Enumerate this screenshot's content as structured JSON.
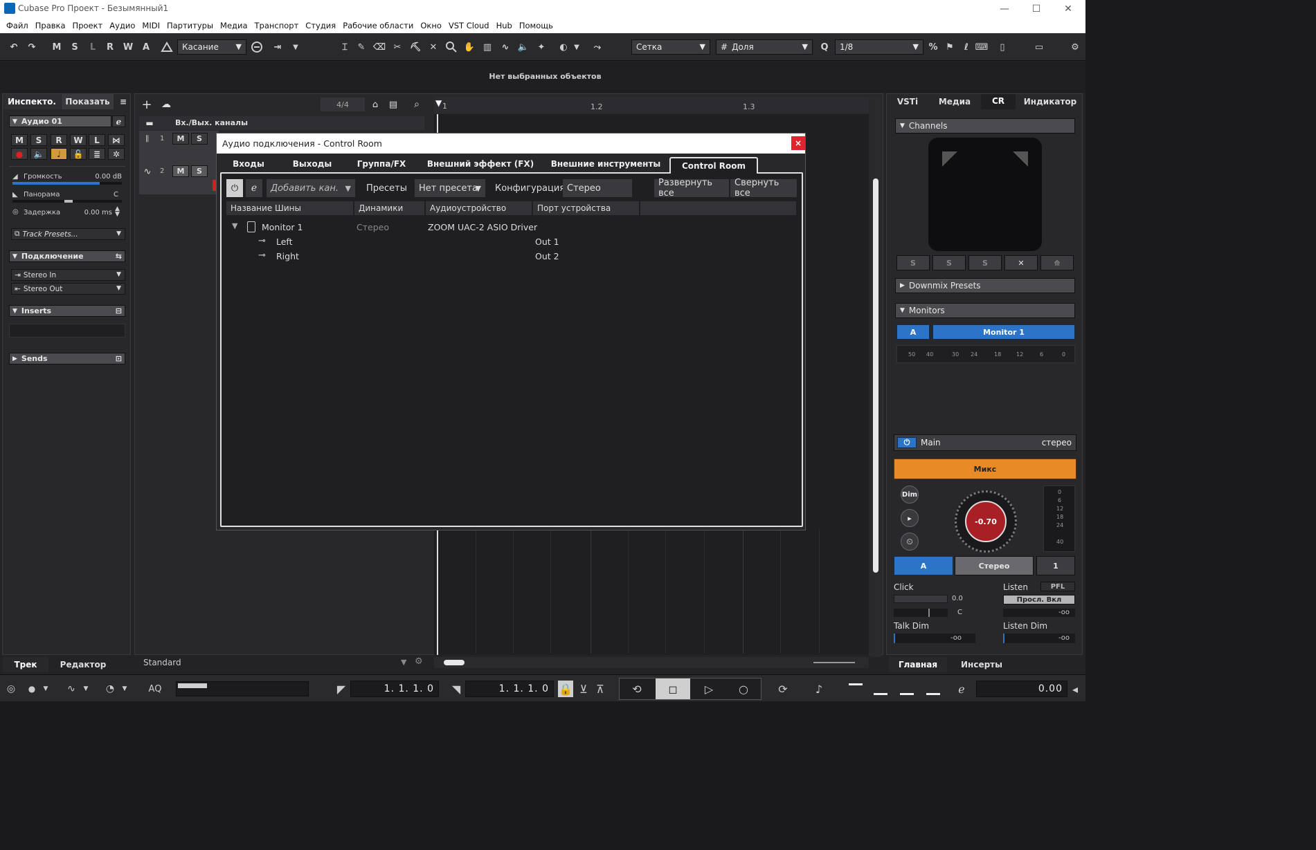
{
  "window": {
    "title": "Cubase Pro Проект - Безымянный1",
    "minimize": "—",
    "maximize": "☐",
    "close": "✕"
  },
  "menu": [
    "Файл",
    "Правка",
    "Проект",
    "Аудио",
    "MIDI",
    "Партитуры",
    "Медиа",
    "Транспорт",
    "Студия",
    "Рабочие области",
    "Окно",
    "VST Cloud",
    "Hub",
    "Помощь"
  ],
  "toolbar": {
    "undo": "↶",
    "redo": "↷",
    "m": "M",
    "s": "S",
    "l": "L",
    "r": "R",
    "w": "W",
    "a": "A",
    "automation_mode": "Касание",
    "snap_type": "Сетка",
    "grid_type": "Доля",
    "quantize": "1/8"
  },
  "info_line": "Нет выбранных объектов",
  "inspector": {
    "tabs": [
      "Инспекто.",
      "Показать"
    ],
    "track_name": "Аудио 01",
    "btns": [
      "M",
      "S",
      "R",
      "W",
      "L"
    ],
    "volume_label": "Громкость",
    "volume_value": "0.00 dB",
    "volume_level": 0.8,
    "pan_label": "Панорама",
    "pan_value": "C",
    "delay_label": "Задержка",
    "delay_value": "0.00 ms",
    "track_presets": "Track Presets...",
    "routing_section": "Подключение",
    "input": "Stereo In",
    "output": "Stereo Out",
    "inserts_section": "Inserts",
    "sends_section": "Sends"
  },
  "project": {
    "signature": "4/4",
    "folder_name": "Вх./Вых. каналы",
    "track1_num": "1",
    "track2_num": "2",
    "m": "M",
    "s": "S",
    "ruler": [
      "1",
      "1.2",
      "1.3"
    ],
    "preset_name": "Standard"
  },
  "dialog": {
    "title": "Аудио подключения - Control Room",
    "close": "×",
    "tabs": [
      "Входы",
      "Выходы",
      "Группа/FX",
      "Внешний эффект (FX)",
      "Внешние инструменты",
      "Control Room"
    ],
    "active_tab": "Control Room",
    "add_channel": "Добавить кан.",
    "presets_label": "Пресеты",
    "preset_value": "Нет пресета",
    "config_label": "Конфигурация",
    "config_value": "Стерео",
    "expand_all": "Развернуть все",
    "collapse_all": "Свернуть все",
    "columns": [
      "Название Шины",
      "Динамики",
      "Аудиоустройство",
      "Порт устройства"
    ],
    "rows": [
      {
        "name": "Monitor 1",
        "speakers": "Стерео",
        "device": "ZOOM UAC-2 ASIO Driver",
        "port": ""
      },
      {
        "name": "Left",
        "speakers": "",
        "device": "",
        "port": "Out 1"
      },
      {
        "name": "Right",
        "speakers": "",
        "device": "",
        "port": "Out 2"
      }
    ]
  },
  "right_zone": {
    "tabs": [
      "VSTi",
      "Медиа",
      "CR",
      "Индикатор"
    ],
    "active_tab": "CR",
    "channels": "Channels",
    "downmix": "Downmix Presets",
    "monitors": "Monitors",
    "monitor_a": "A",
    "monitor_name": "Monitor 1",
    "meter_scale": [
      "50",
      "40",
      "30",
      "24",
      "18",
      "12",
      "6",
      "0"
    ],
    "main_label": "Main",
    "main_format": "стерео",
    "mix_button": "Микс",
    "dim": "Dim",
    "knob_value": "-0.70",
    "vu_scale": [
      "0",
      "6",
      "12",
      "18",
      "24",
      "40"
    ],
    "a_button": "A",
    "stereo_button": "Стерео",
    "one_button": "1",
    "click_label": "Click",
    "click_value": "0.0",
    "click_pan": "C",
    "listen_label": "Listen",
    "pfl": "PFL",
    "listen_enable": "Просл. Вкл",
    "listen_value": "-oo",
    "talk_dim": "Talk Dim",
    "talk_dim_value": "-oo",
    "listen_dim": "Listen Dim",
    "listen_dim_value": "-oo"
  },
  "bottom_tabs": {
    "left": [
      "Трек",
      "Редактор"
    ],
    "right": [
      "Главная",
      "Инсерты"
    ]
  },
  "transport": {
    "aq": "AQ",
    "left_locator": "1. 1. 1.   0",
    "right_locator": "1. 1. 1.   0",
    "tempo_display": "0.00"
  }
}
